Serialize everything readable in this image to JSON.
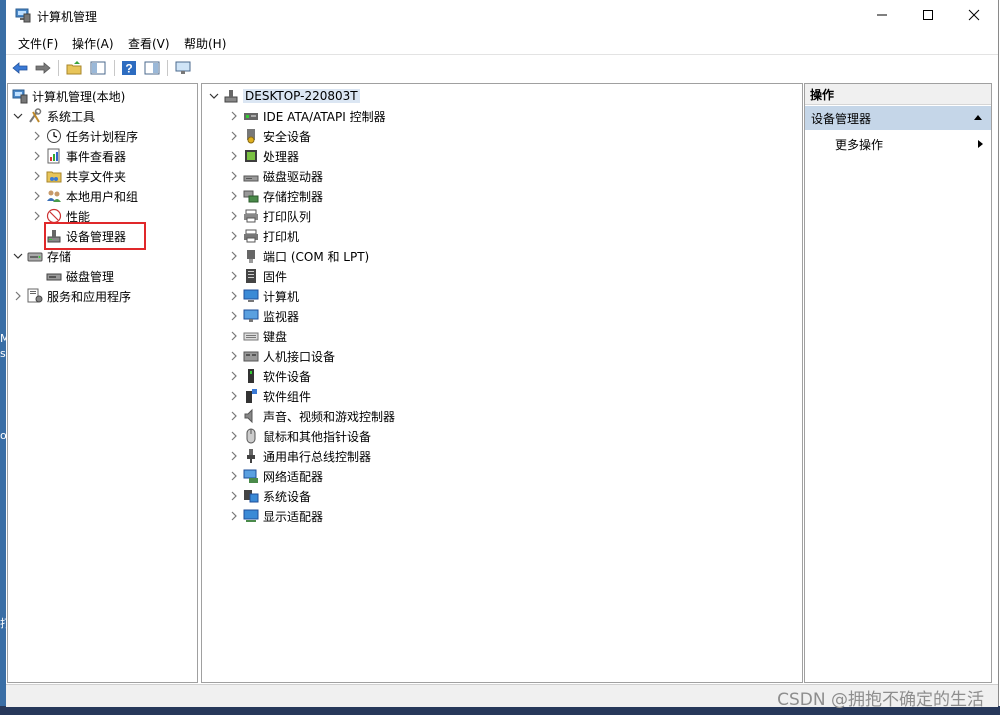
{
  "window": {
    "title": "计算机管理"
  },
  "menu": [
    "文件(F)",
    "操作(A)",
    "查看(V)",
    "帮助(H)"
  ],
  "toolbar": [
    {
      "name": "back-arrow-icon"
    },
    {
      "name": "forward-arrow-icon"
    },
    {
      "name": "up-folder-icon"
    },
    {
      "name": "show-hide-tree-icon"
    },
    {
      "name": "help-icon"
    },
    {
      "name": "action-pane-icon"
    },
    {
      "name": "monitor-icon"
    }
  ],
  "left_tree": {
    "root": "计算机管理(本地)",
    "system_tools": "系统工具",
    "system_children": [
      "任务计划程序",
      "事件查看器",
      "共享文件夹",
      "本地用户和组",
      "性能",
      "设备管理器"
    ],
    "storage": "存储",
    "storage_children": [
      "磁盘管理"
    ],
    "services": "服务和应用程序"
  },
  "device_tree": {
    "root": "DESKTOP-220803T",
    "items": [
      {
        "label": "IDE ATA/ATAPI 控制器",
        "icon": "ide-controller-icon"
      },
      {
        "label": "安全设备",
        "icon": "security-device-icon"
      },
      {
        "label": "处理器",
        "icon": "processor-icon"
      },
      {
        "label": "磁盘驱动器",
        "icon": "disk-drive-icon"
      },
      {
        "label": "存储控制器",
        "icon": "storage-controller-icon"
      },
      {
        "label": "打印队列",
        "icon": "print-queue-icon"
      },
      {
        "label": "打印机",
        "icon": "printer-icon"
      },
      {
        "label": "端口 (COM 和 LPT)",
        "icon": "port-icon"
      },
      {
        "label": "固件",
        "icon": "firmware-icon"
      },
      {
        "label": "计算机",
        "icon": "computer-icon"
      },
      {
        "label": "监视器",
        "icon": "monitor-icon"
      },
      {
        "label": "键盘",
        "icon": "keyboard-icon"
      },
      {
        "label": "人机接口设备",
        "icon": "hid-icon"
      },
      {
        "label": "软件设备",
        "icon": "software-device-icon"
      },
      {
        "label": "软件组件",
        "icon": "software-component-icon"
      },
      {
        "label": "声音、视频和游戏控制器",
        "icon": "speaker-icon"
      },
      {
        "label": "鼠标和其他指针设备",
        "icon": "mouse-icon"
      },
      {
        "label": "通用串行总线控制器",
        "icon": "usb-icon"
      },
      {
        "label": "网络适配器",
        "icon": "network-adapter-icon"
      },
      {
        "label": "系统设备",
        "icon": "system-device-icon"
      },
      {
        "label": "显示适配器",
        "icon": "display-adapter-icon"
      }
    ]
  },
  "actions": {
    "header": "操作",
    "selected": "设备管理器",
    "more": "更多操作"
  },
  "watermark": "CSDN @拥抱不确定的生活",
  "desktop_snippets": [
    "M",
    "s",
    "o",
    "打"
  ]
}
